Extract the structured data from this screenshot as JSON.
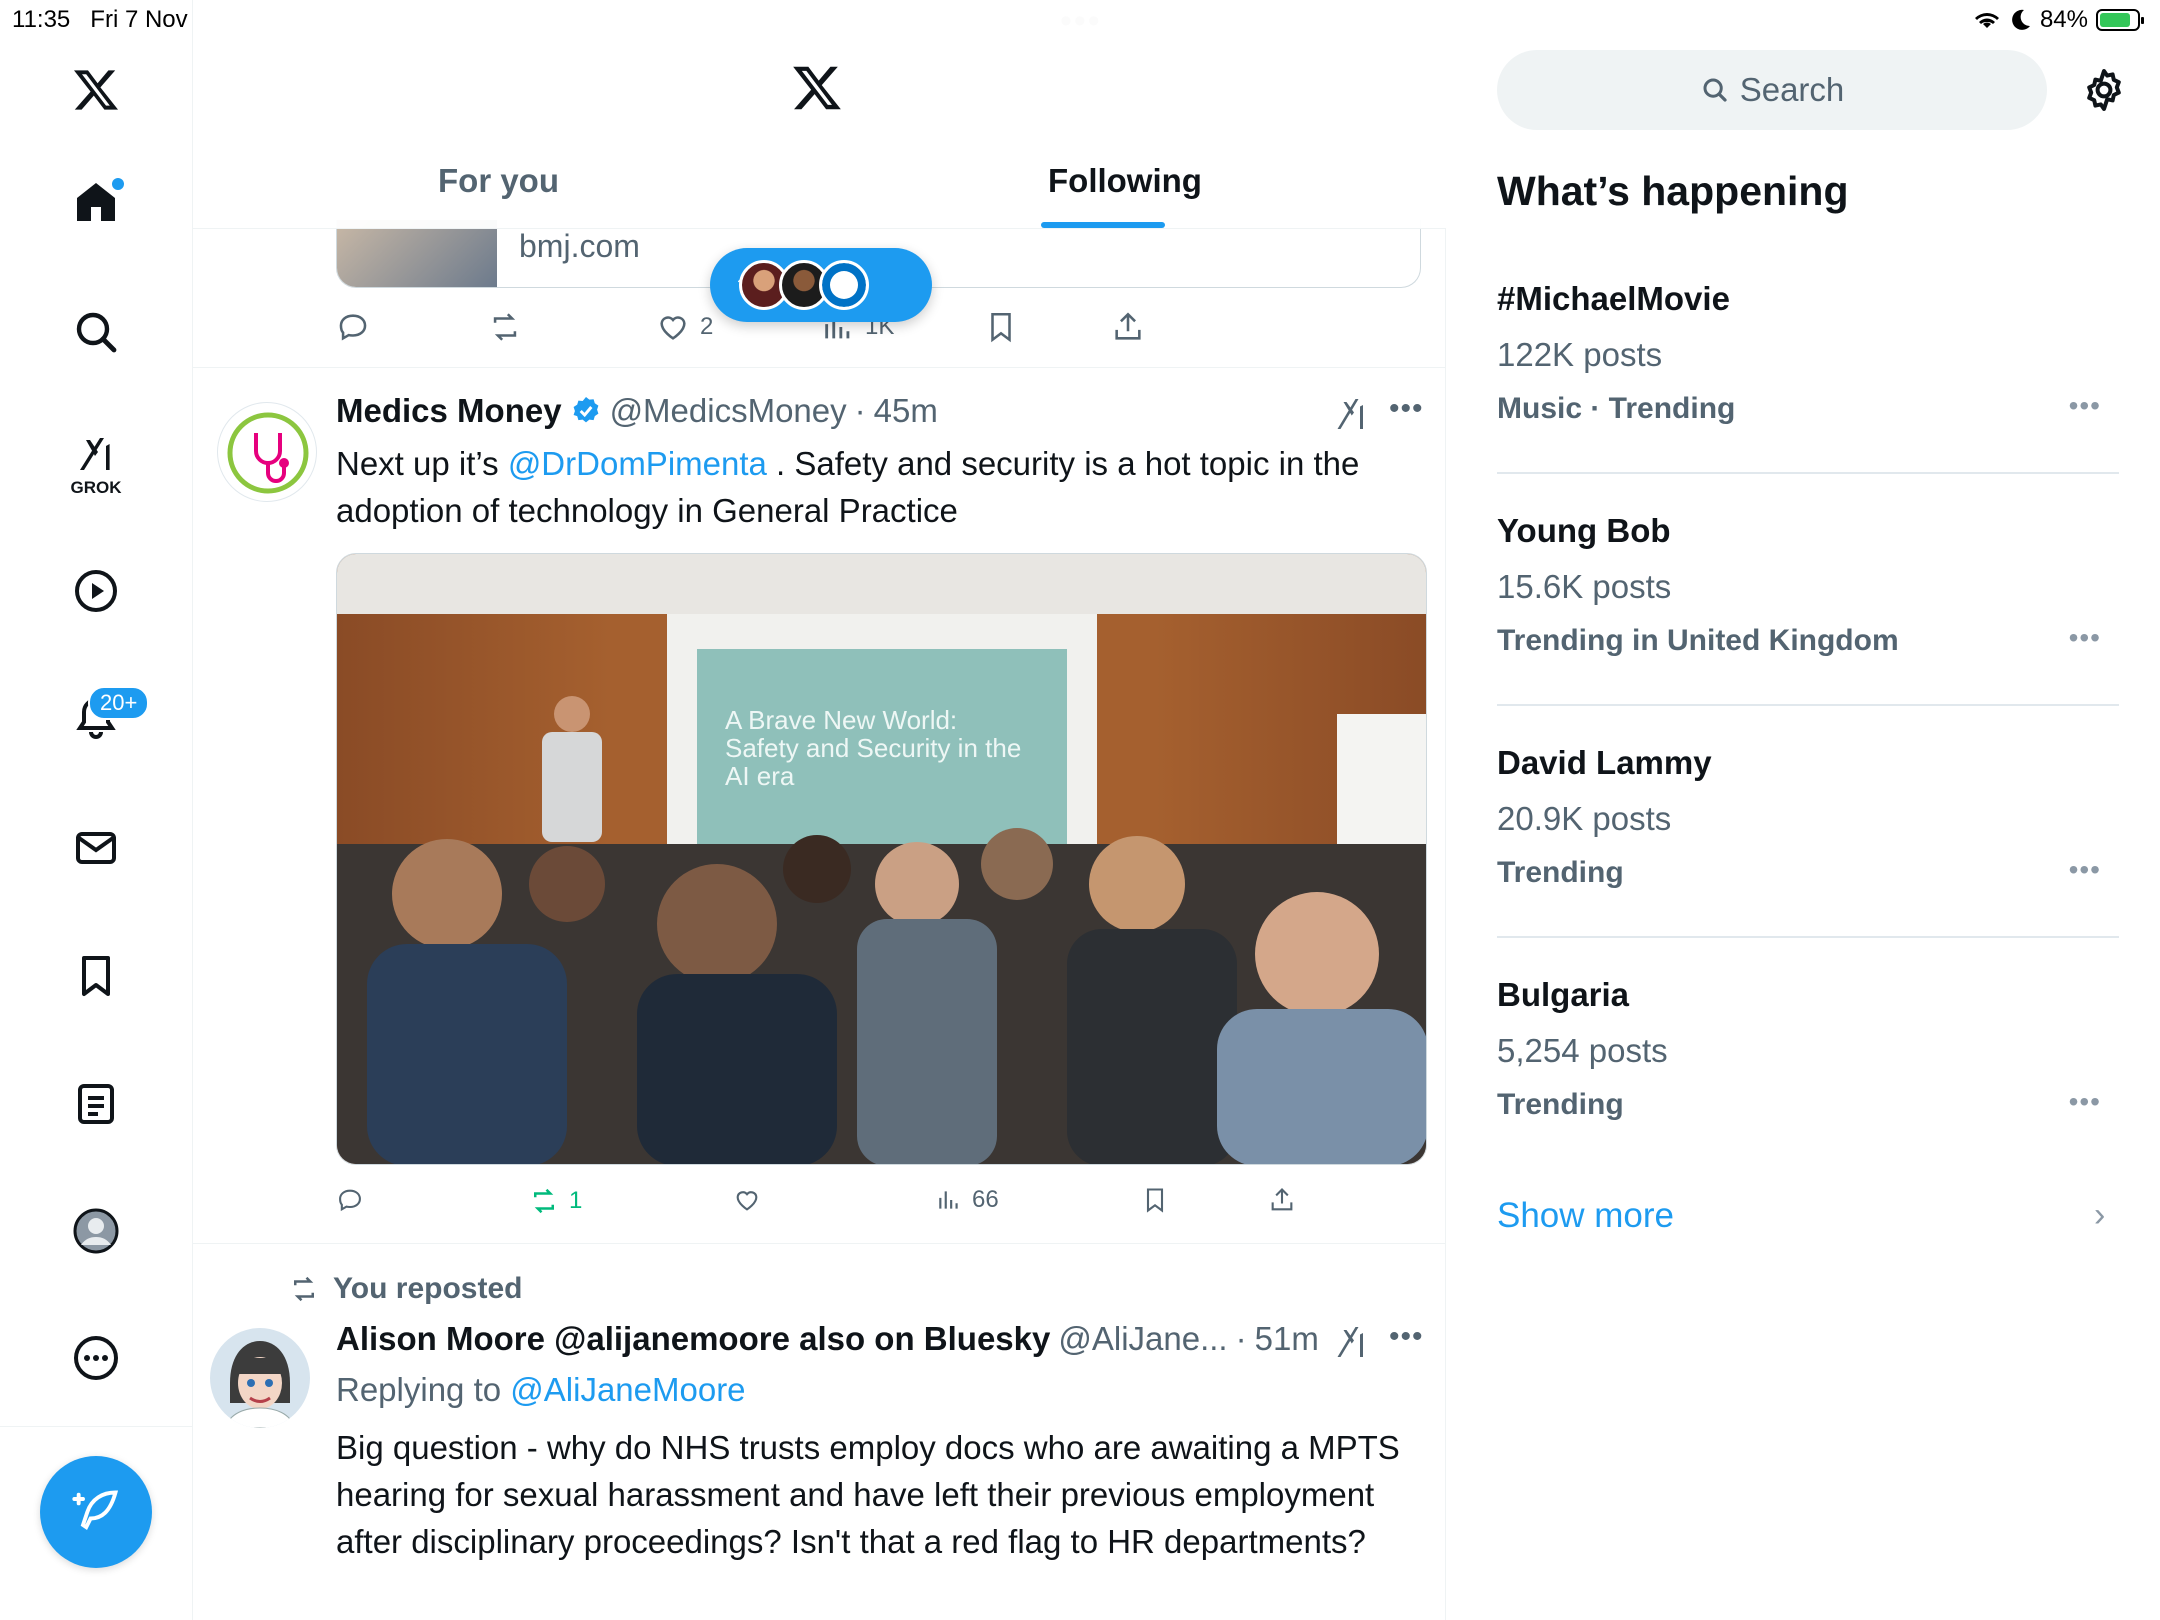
{
  "status_bar": {
    "time": "11:35",
    "date": "Fri 7 Nov",
    "battery": "84%",
    "battery_level": 0.84,
    "icons": [
      "wifi-icon",
      "moon-icon",
      "battery-icon"
    ]
  },
  "nav": {
    "items": [
      "x-logo-icon",
      "home-icon",
      "search-icon",
      "grok-icon",
      "video-icon",
      "notifications-icon",
      "messages-icon",
      "bookmarks-icon",
      "lists-icon",
      "profile-icon",
      "more-icon"
    ],
    "grok_label": "GROK",
    "notifications_badge": "20+",
    "compose_icon": "compose-icon"
  },
  "header": {
    "tabs": [
      {
        "label": "For you",
        "active": false
      },
      {
        "label": "Following",
        "active": true
      }
    ]
  },
  "prev_post": {
    "link_domain": "bmj.com",
    "likes": "2",
    "views": "1K"
  },
  "post1": {
    "name": "Medics Money",
    "verified": true,
    "handle": "@MedicsMoney",
    "separator": "·",
    "time": "45m",
    "text_before": "Next up it’s ",
    "mention": "@DrDomPimenta",
    "text_after": " . Safety and security is a hot topic in the adoption of technology in General Practice",
    "image_slide_text": "A Brave New World: Safety and Security in the AI era",
    "reposts": "1",
    "views": "66"
  },
  "post2": {
    "reposted_label": "You reposted",
    "name": "Alison Moore @alijanemoore also on Bluesky",
    "handle": "@AliJane...",
    "separator": "·",
    "time": "51m",
    "replying_label": "Replying to ",
    "replying_to": "@AliJaneMoore",
    "text": "Big question - why do NHS trusts employ docs who are awaiting a MPTS hearing for sexual harassment and have left their previous employment after disciplinary proceedings? Isn't that a red flag to HR departments?"
  },
  "sidebar": {
    "search_placeholder": "Search",
    "title": "What’s happening",
    "trends": [
      {
        "name": "#MichaelMovie",
        "posts": "122K posts",
        "meta": "Music · Trending"
      },
      {
        "name": "Young Bob",
        "posts": "15.6K posts",
        "meta": "Trending in United Kingdom"
      },
      {
        "name": "David Lammy",
        "posts": "20.9K posts",
        "meta": "Trending"
      },
      {
        "name": "Bulgaria",
        "posts": "5,254 posts",
        "meta": "Trending"
      }
    ],
    "show_more": "Show more"
  },
  "colors": {
    "accent": "#1d9bf0",
    "text": "#0f1419",
    "secondary": "#536471",
    "repost_green": "#00ba7c"
  }
}
